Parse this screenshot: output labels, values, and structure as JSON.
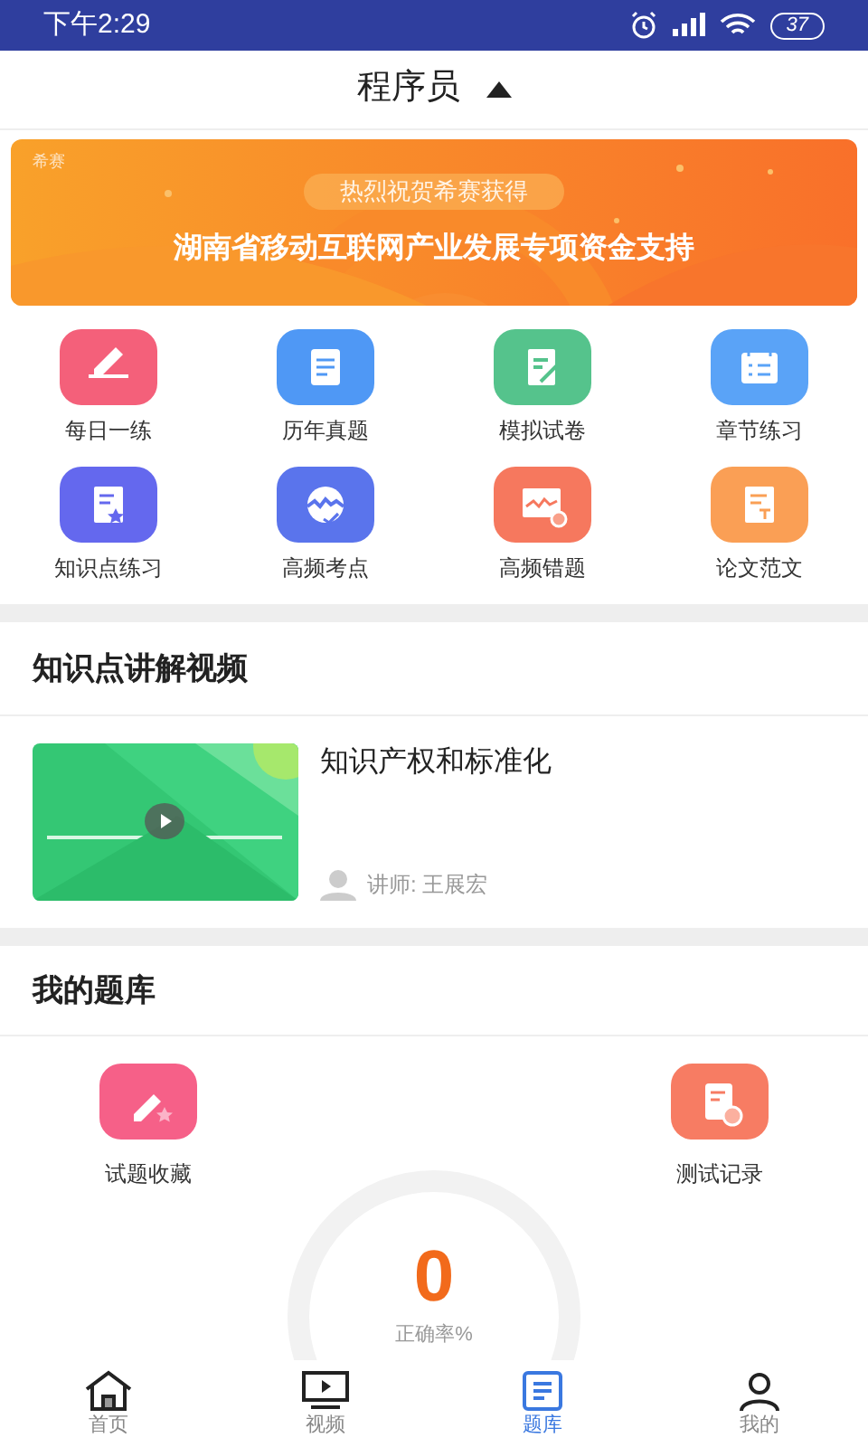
{
  "status_bar": {
    "time": "下午2:29",
    "battery": "37"
  },
  "header": {
    "title": "程序员",
    "expanded": true
  },
  "banner": {
    "brand": "希赛",
    "tagline": "热烈祝贺希赛获得",
    "headline": "湖南省移动互联网产业发展专项资金支持"
  },
  "shortcuts": [
    {
      "label": "每日一练",
      "color": "#f4607a"
    },
    {
      "label": "历年真题",
      "color": "#4f98f5"
    },
    {
      "label": "模拟试卷",
      "color": "#55c38c"
    },
    {
      "label": "章节练习",
      "color": "#5aa3f7"
    },
    {
      "label": "知识点练习",
      "color": "#6468ee"
    },
    {
      "label": "高频考点",
      "color": "#5a74ec"
    },
    {
      "label": "高频错题",
      "color": "#f6785e"
    },
    {
      "label": "论文范文",
      "color": "#fa9f55"
    }
  ],
  "video_section": {
    "title": "知识点讲解视频",
    "videos": [
      {
        "title": "知识产权和标准化",
        "lecturer": "讲师: 王展宏"
      }
    ]
  },
  "bank_section": {
    "title": "我的题库",
    "entries": [
      {
        "label": "试题收藏",
        "color": "#f66088"
      },
      {
        "label": "测试记录",
        "color": "#f77c63"
      }
    ],
    "accuracy": {
      "value": "0",
      "label": "正确率%"
    }
  },
  "tab_bar": [
    {
      "label": "首页",
      "selected": false
    },
    {
      "label": "视频",
      "selected": false
    },
    {
      "label": "题库",
      "selected": true
    },
    {
      "label": "我的",
      "selected": false
    }
  ]
}
